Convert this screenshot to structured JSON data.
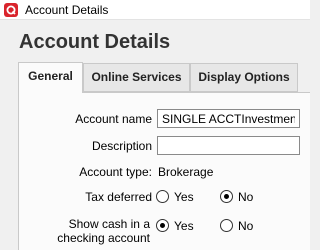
{
  "window": {
    "title": "Account Details"
  },
  "heading": "Account Details",
  "tabs": [
    {
      "label": "General",
      "selected": true
    },
    {
      "label": "Online Services",
      "selected": false
    },
    {
      "label": "Display Options",
      "selected": false
    }
  ],
  "form": {
    "account_name": {
      "label": "Account name",
      "value": "SINGLE ACCTInvestment XX"
    },
    "description": {
      "label": "Description",
      "value": ""
    },
    "account_type": {
      "label": "Account type:",
      "value": "Brokerage"
    },
    "tax_deferred": {
      "label": "Tax deferred",
      "yes_label": "Yes",
      "no_label": "No",
      "selected": "No"
    },
    "show_cash": {
      "label_line1": "Show cash in a",
      "label_line2": "checking account",
      "yes_label": "Yes",
      "no_label": "No",
      "selected": "Yes"
    }
  },
  "colors": {
    "app_icon": "#d9242c",
    "background": "#f0f0f0",
    "panel": "#fbfbfb"
  },
  "icons": {
    "app": "quicken-q-icon"
  }
}
